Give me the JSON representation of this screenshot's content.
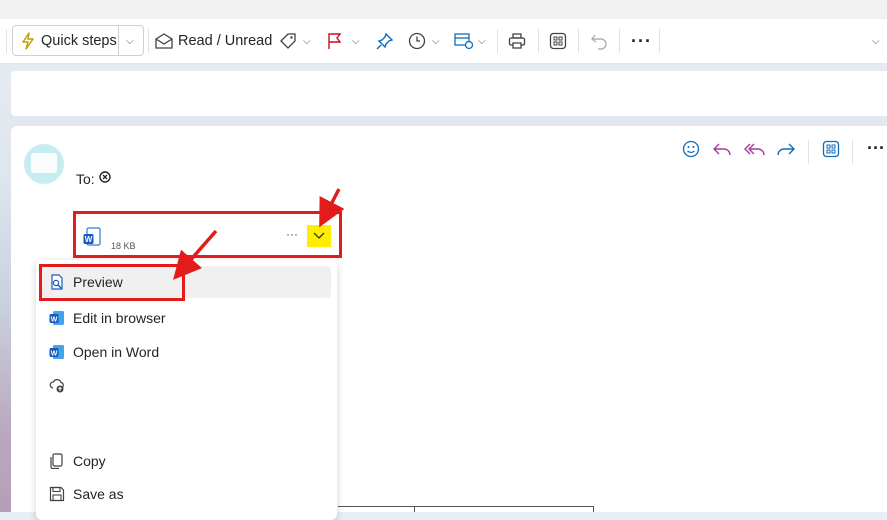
{
  "toolbar": {
    "quick_steps_label": "Quick steps",
    "read_unread_label": "Read / Unread",
    "icons": [
      "lightning-icon",
      "chevron-down-icon",
      "envelope-open-icon",
      "tag-icon",
      "chevron-down-icon",
      "flag-icon",
      "chevron-down-icon",
      "pin-icon",
      "clock-icon",
      "chevron-down-icon",
      "rules-icon",
      "chevron-down-icon",
      "print-icon",
      "apps-icon",
      "undo-icon",
      "more-icon",
      "expand-icon"
    ]
  },
  "reading_pane": {
    "to_label": "To:",
    "attachment": {
      "size": "18 KB",
      "more": "···",
      "file_icon": "word-document-icon"
    }
  },
  "context_menu": {
    "items": [
      {
        "label": "Preview",
        "icon": "preview-icon"
      },
      {
        "label": "Edit in browser",
        "icon": "word-icon"
      },
      {
        "label": "Open in Word",
        "icon": "word-icon"
      },
      {
        "label": "",
        "icon": "cloud-upload-icon"
      },
      {
        "label": "Copy",
        "icon": "copy-icon"
      },
      {
        "label": "Save as",
        "icon": "save-icon"
      }
    ]
  },
  "colors": {
    "accent": "#0f6cbd",
    "annotation_red": "#e21b1b",
    "highlight_yellow": "#ffee00",
    "flag": "#c50f1f"
  }
}
